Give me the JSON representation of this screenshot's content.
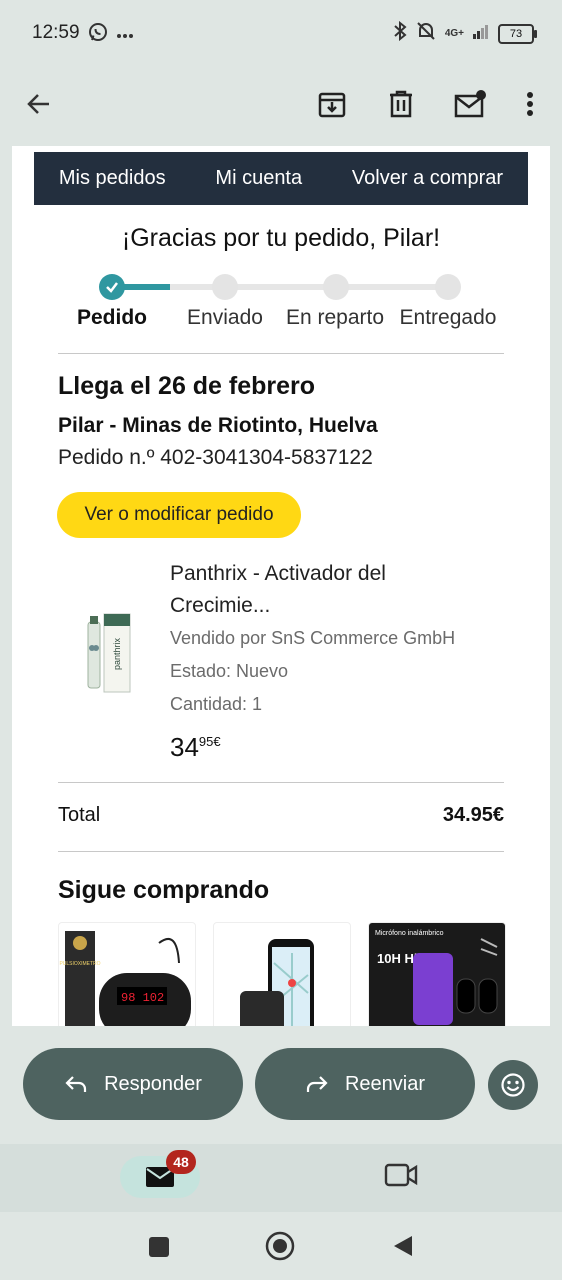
{
  "status_bar": {
    "time": "12:59",
    "battery": "73",
    "network": "4G+"
  },
  "email": {
    "nav_links": [
      "Mis pedidos",
      "Mi cuenta",
      "Volver a comprar"
    ],
    "thanks": "¡Gracias por tu pedido, Pilar!",
    "progress": {
      "steps": [
        "Pedido",
        "Enviado",
        "En reparto",
        "Entregado"
      ],
      "current_step": 0
    },
    "arrival": "Llega el 26 de febrero",
    "address": "Pilar - Minas de Riotinto, Huelva",
    "order_number": "Pedido n.º 402-3041304-5837122",
    "modify_button": "Ver o modificar pedido",
    "product": {
      "name_line1": "Panthrix - Activador del",
      "name_line2": "Crecimie...",
      "seller": "Vendido por SnS Commerce GmbH",
      "state": "Estado: Nuevo",
      "quantity": "Cantidad: 1",
      "price_int": "34",
      "price_dec": "95€",
      "thumb_text": "panthrix"
    },
    "total_label": "Total",
    "total_value": "34.95€",
    "keep_shopping": "Sigue comprando",
    "recs": [
      {
        "label": "PULSIOXIMETRO",
        "display": "98 102"
      },
      {
        "label": ""
      },
      {
        "label": "Micrófono inalámbrico",
        "sub": "10H Hifi"
      }
    ]
  },
  "actions": {
    "reply": "Responder",
    "forward": "Reenviar"
  },
  "bottom_nav": {
    "badge": "48"
  },
  "colors": {
    "accent": "#2f97a0",
    "nav_bg": "#232f3e",
    "button_yellow": "#ffd814",
    "action_btn": "#4e6360"
  }
}
